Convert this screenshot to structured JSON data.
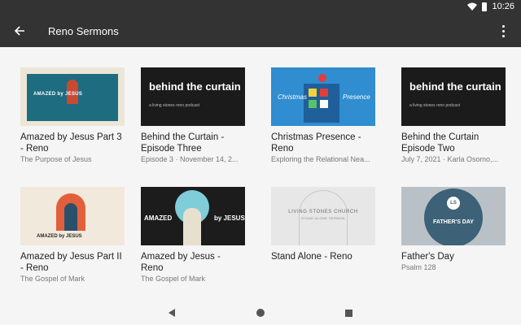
{
  "status_bar": {
    "time": "10:26"
  },
  "app_bar": {
    "title": "Reno Sermons"
  },
  "items": [
    {
      "title": "Amazed by Jesus Part 3 - Reno",
      "subtitle": "The Purpose of Jesus",
      "thumb_text": "AMAZED by JESUS"
    },
    {
      "title": "Behind the Curtain - Episode Three",
      "subtitle": "Episode 3 · November 14, 2...",
      "thumb_text": "behind the curtain",
      "thumb_small": "a living stones reno podcast"
    },
    {
      "title": "Christmas Presence - Reno",
      "subtitle": "Exploring the Relational Nea...",
      "thumb_left": "Christmas",
      "thumb_right": "Presence"
    },
    {
      "title": "Behind the Curtain Episode Two",
      "subtitle": "July 7, 2021 · Karla Osomo,...",
      "thumb_text": "behind the curtain",
      "thumb_small": "a living stones reno podcast"
    },
    {
      "title": "Amazed by Jesus Part II - Reno",
      "subtitle": "The Gospel of Mark",
      "thumb_text": "AMAZED by JESUS"
    },
    {
      "title": "Amazed by Jesus - Reno",
      "subtitle": "The Gospel of Mark",
      "thumb_left": "AMAZED",
      "thumb_right": "by JESUS"
    },
    {
      "title": "Stand Alone - Reno",
      "subtitle": "",
      "thumb_text": "LIVING STONES CHURCH",
      "thumb_small": "STAND ALONE SERMON"
    },
    {
      "title": "Father's Day",
      "subtitle": "Psalm 128",
      "thumb_text": "FATHER'S DAY",
      "thumb_logo": "LS"
    }
  ]
}
